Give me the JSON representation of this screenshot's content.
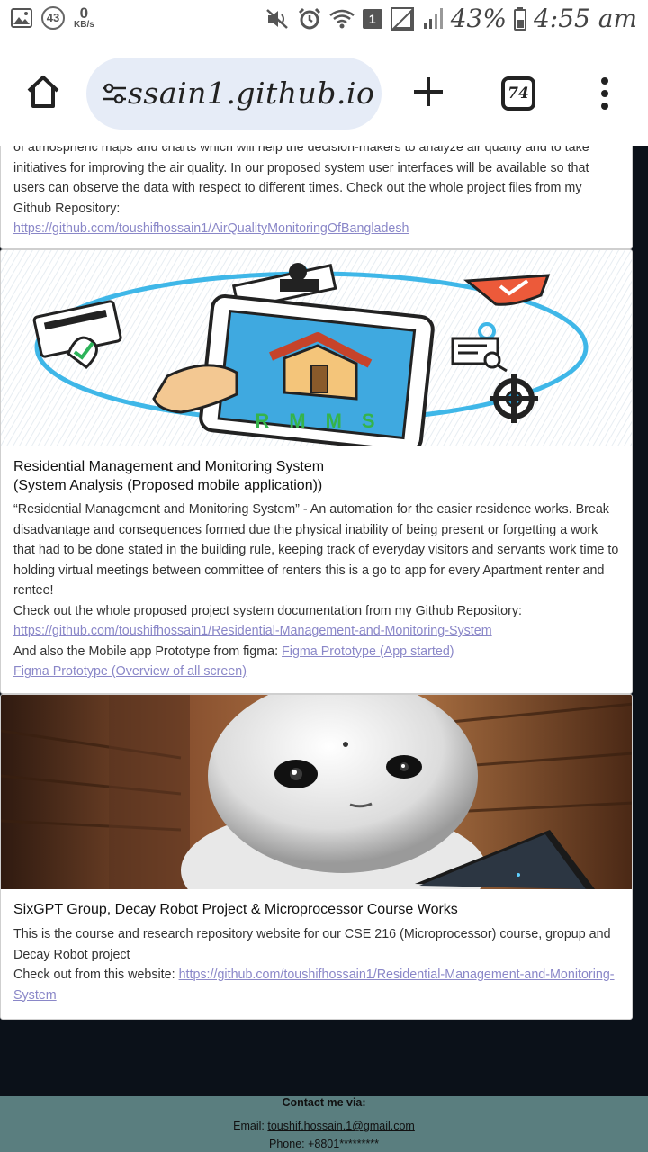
{
  "status_bar": {
    "notification_count": "43",
    "speed_value": "0",
    "speed_unit": "KB/s",
    "sim_label": "1",
    "battery": "43%",
    "time": "4:55 am"
  },
  "browser": {
    "url": "ssain1.github.io",
    "tab_count": "74"
  },
  "projects": [
    {
      "description_partial": "of atmospheric maps and charts which will help the decision-makers to analyze air quality and to take initiatives for improving the air quality. In our proposed system user interfaces will be available so that users can observe the data with respect to different times. Check out the whole project files from my Github Repository:",
      "link": "https://github.com/toushifhossain1/AirQualityMonitoringOfBangladesh"
    },
    {
      "image_text": "RMMS",
      "title_line1": "Residential Management and Monitoring System",
      "title_line2": "(System Analysis (Proposed mobile application))",
      "description": "“Residential Management and Monitoring System” - An automation for the easier residence works. Break disadvantage and consequences formed due the physical inability of being present or forgetting a work that had to be done stated in the building rule, keeping track of everyday visitors and servants work time to holding virtual meetings between committee of renters this is a go to app for every Apartment renter and rentee!",
      "checkout_text": "Check out the whole proposed project system documentation from my Github Repository:",
      "link": "https://github.com/toushifhossain1/Residential-Management-and-Monitoring-System",
      "figma_prefix": "And also the Mobile app Prototype from figma:",
      "figma_link1": "Figma Prototype (App started)",
      "figma_link2": "Figma Prototype (Overview of all screen)"
    },
    {
      "title": "SixGPT Group, Decay Robot Project & Microprocessor Course Works",
      "description": "This is the course and research repository website for our CSE 216 (Microprocessor) course, gropup and Decay Robot project",
      "checkout_prefix": "Check out from this website:",
      "link": "https://github.com/toushifhossain1/Residential-Management-and-Monitoring-System"
    }
  ],
  "footer": {
    "title": "Contact me via:",
    "email_label": "Email:",
    "email": "toushif.hossain.1@gmail.com",
    "phone": "Phone: +8801*********"
  }
}
